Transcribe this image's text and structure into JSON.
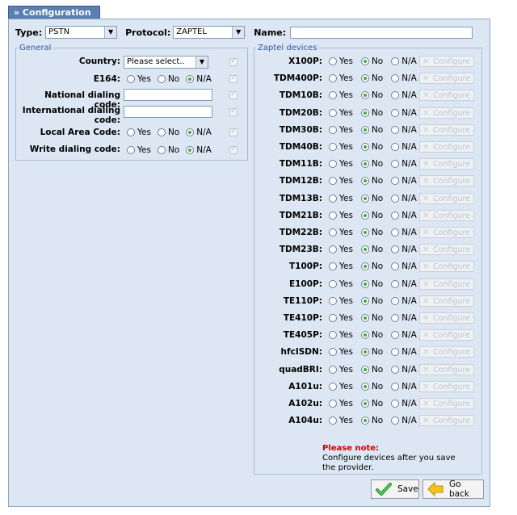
{
  "tab_title": "» Configuration",
  "header": {
    "type_label": "Type:",
    "type_value": "PSTN",
    "protocol_label": "Protocol:",
    "protocol_value": "ZAPTEL",
    "name_label": "Name:",
    "name_value": ""
  },
  "general": {
    "legend": "General",
    "country_label": "Country:",
    "country_value": "Please select..",
    "e164_label": "E164:",
    "national_label": "National dialing code:",
    "international_label_1": "International dialing",
    "international_label_2": "code:",
    "local_label": "Local Area Code:",
    "write_label": "Write dialing code:",
    "opt_yes": "Yes",
    "opt_no": "No",
    "opt_na": "N/A"
  },
  "zaptel": {
    "legend": "Zaptel devices",
    "configure_label": "Configure",
    "opt_yes": "Yes",
    "opt_no": "No",
    "opt_na": "N/A",
    "devices": [
      {
        "label": "X100P:"
      },
      {
        "label": "TDM400P:"
      },
      {
        "label": "TDM10B:"
      },
      {
        "label": "TDM20B:"
      },
      {
        "label": "TDM30B:"
      },
      {
        "label": "TDM40B:"
      },
      {
        "label": "TDM11B:"
      },
      {
        "label": "TDM12B:"
      },
      {
        "label": "TDM13B:"
      },
      {
        "label": "TDM21B:"
      },
      {
        "label": "TDM22B:"
      },
      {
        "label": "TDM23B:"
      },
      {
        "label": "T100P:"
      },
      {
        "label": "E100P:"
      },
      {
        "label": "TE110P:"
      },
      {
        "label": "TE410P:"
      },
      {
        "label": "TE405P:"
      },
      {
        "label": "hfcISDN:"
      },
      {
        "label": "quadBRI:"
      },
      {
        "label": "A101u:"
      },
      {
        "label": "A102u:"
      },
      {
        "label": "A104u:"
      }
    ],
    "note_title": "Please note:",
    "note_text": "Configure devices after you save the provider."
  },
  "buttons": {
    "save": "Save",
    "goback": "Go back"
  },
  "colors": {
    "panel_bg": "#dde7f3",
    "tab_bg": "#5a7fb0",
    "legend": "#2e55a8",
    "note_title": "#d40000"
  },
  "icons": {
    "save": "green-check-icon",
    "goback": "yellow-arrow-left-icon",
    "configure": "tools-icon"
  }
}
